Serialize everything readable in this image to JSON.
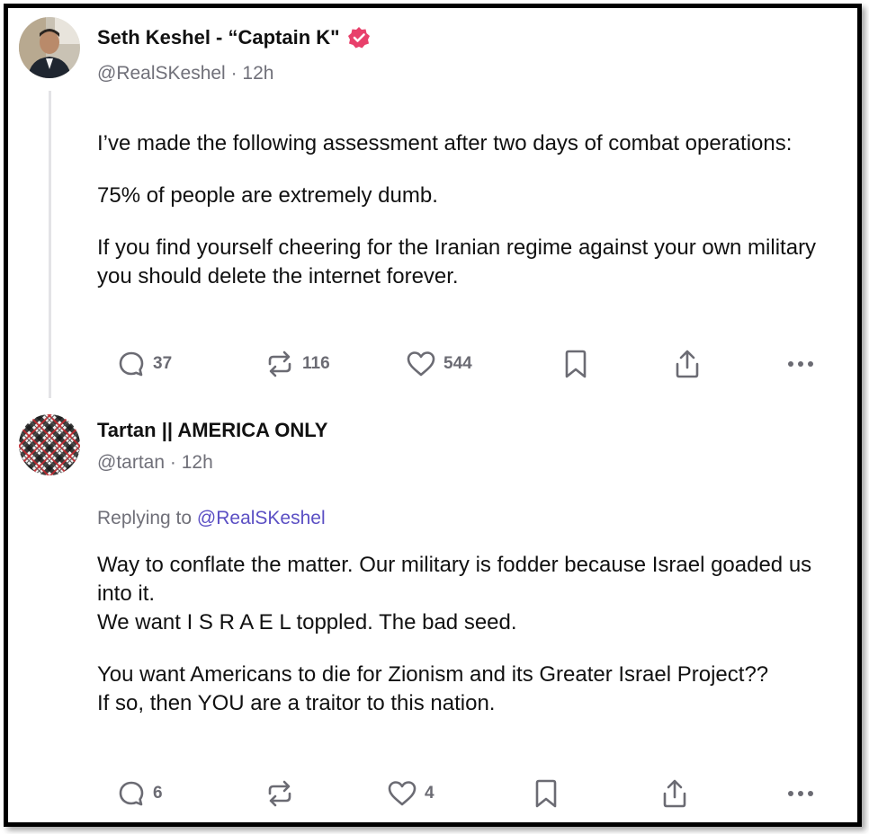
{
  "posts": [
    {
      "author": {
        "display_name": "Seth Keshel - “Captain K\"",
        "handle": "@RealSKeshel",
        "time": "12h",
        "verified": true,
        "avatar_icon": "profile-photo"
      },
      "paragraphs": [
        "I’ve made the following assessment after two days of combat operations:",
        "75% of people are extremely dumb.",
        "If you find yourself cheering for the Iranian regime against your own military you should delete the internet forever."
      ],
      "actions": {
        "replies": "37",
        "reposts": "116",
        "likes": "544"
      }
    },
    {
      "author": {
        "display_name": "Tartan || AMERICA ONLY",
        "handle": "@tartan",
        "time": "12h",
        "verified": false,
        "avatar_icon": "tartan-pattern"
      },
      "replying_to_label": "Replying to",
      "replying_to_handle": "@RealSKeshel",
      "paragraphs": [
        "Way to conflate the matter.  Our military is fodder because Israel goaded us into it.\nWe want I S R A E L toppled.  The bad seed.",
        "You want Americans to die for Zionism and its Greater Israel Project??\nIf so, then YOU are a traitor to this nation."
      ],
      "actions": {
        "replies": "6",
        "reposts": "",
        "likes": "4"
      }
    }
  ],
  "colors": {
    "verified_badge": "#e8406b",
    "mention": "#5b4fc4",
    "muted": "#707079"
  },
  "separator": "·"
}
